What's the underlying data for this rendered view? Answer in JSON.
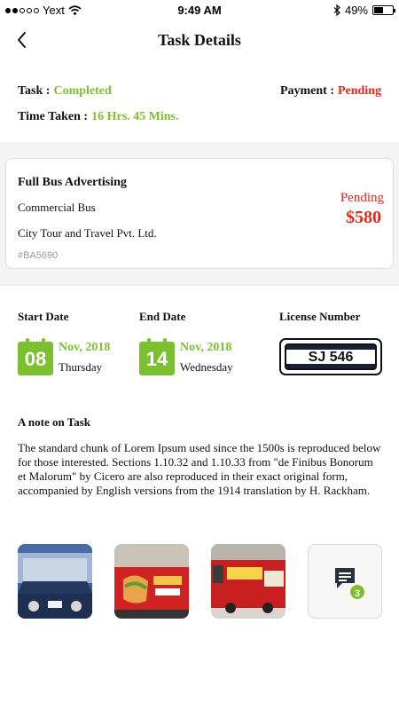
{
  "status_bar": {
    "carrier": "Yext",
    "time": "9:49 AM",
    "battery_percent": "49%",
    "battery_level": 0.49
  },
  "nav": {
    "title": "Task Details",
    "back_icon": "chevron-left-icon"
  },
  "summary": {
    "task_label": "Task :",
    "task_value": "Completed",
    "payment_label": "Payment :",
    "payment_value": "Pending",
    "time_label": "Time Taken :",
    "time_value": "16 Hrs. 45 Mins."
  },
  "card": {
    "title": "Full Bus Advertising",
    "vehicle_type": "Commercial Bus",
    "company": "City Tour and Travel Pvt. Ltd.",
    "id": "#BA5690",
    "status": "Pending",
    "price": "$580"
  },
  "dates": {
    "start_label": "Start Date",
    "end_label": "End Date",
    "license_label": "License Number",
    "start_day": "08",
    "start_month": "Nov, 2018",
    "start_weekday": "Thursday",
    "end_day": "14",
    "end_month": "Nov, 2018",
    "end_weekday": "Wednesday",
    "license_number": "SJ 546"
  },
  "note": {
    "title": "A note on Task",
    "body": "The standard chunk of Lorem Ipsum used since the 1500s is reproduced below for those interested. Sections 1.10.32 and 1.10.33 from \"de Finibus Bonorum et Malorum\" by Cicero are also reproduced in their exact original form, accompanied by English versions from the 1914 translation by H. Rackham."
  },
  "gallery": {
    "chat_icon": "chat-bubble-icon",
    "comment_count": "3"
  },
  "colors": {
    "accent_green": "#7cbf2f",
    "status_red": "#e8261b",
    "plate_navy": "#1a1f33"
  }
}
